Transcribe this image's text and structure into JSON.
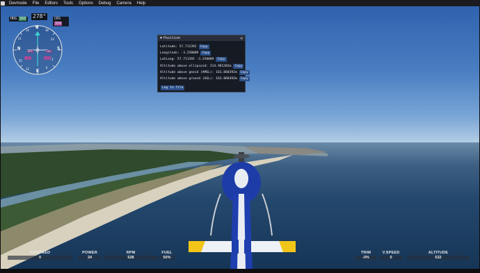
{
  "menu": {
    "items": [
      "Devmode",
      "File",
      "Editors",
      "Tools",
      "Options",
      "Debug",
      "Camera",
      "Help"
    ]
  },
  "compass": {
    "hdg_label": "HDG",
    "hdg_value": "360",
    "heading": "278°",
    "crs_label": "CRS",
    "crs_value": "359",
    "cardinals": [
      "W",
      "N",
      "E",
      "S"
    ],
    "numbers": [
      "24",
      "30",
      "33",
      "3",
      "6",
      "12",
      "15",
      "21"
    ],
    "flags": [
      "GPS",
      "LOC"
    ]
  },
  "position_panel": {
    "title": "Position",
    "rows": [
      {
        "label": "Latitude: 57.711392",
        "button": "Copy"
      },
      {
        "label": "Longitude: -3.250009",
        "button": "Copy"
      },
      {
        "label": "LatLong: 57.711392 -3.250009",
        "button": "Copy"
      },
      {
        "label": "Altitude above ellipsoid: 214.981202m",
        "button": "Copy"
      },
      {
        "label": "Altitude above geoid (AMSL): 163.860392m",
        "button": "Copy"
      },
      {
        "label": "Altitude above ground (AGL): 163.860393m",
        "button": "Copy"
      }
    ],
    "log_button": "Log to file"
  },
  "hud": {
    "airspeed": {
      "label": "AIRSPEED",
      "value": "0"
    },
    "power": {
      "label": "POWER",
      "value": "24"
    },
    "rpm": {
      "label": "RPM",
      "value": "528"
    },
    "fuel": {
      "label": "FUEL",
      "value": "50%"
    },
    "trim": {
      "label": "TRIM",
      "value": "-0%"
    },
    "vspeed": {
      "label": "V.SPEED",
      "value": "0"
    },
    "altitude": {
      "label": "ALTITUDE",
      "value": "532"
    }
  },
  "colors": {
    "menubar": "#1b1b1f",
    "panel": "#12141a",
    "button": "#2b4f86",
    "heli_blue": "#1f3fae",
    "heli_yellow": "#f2c519"
  }
}
